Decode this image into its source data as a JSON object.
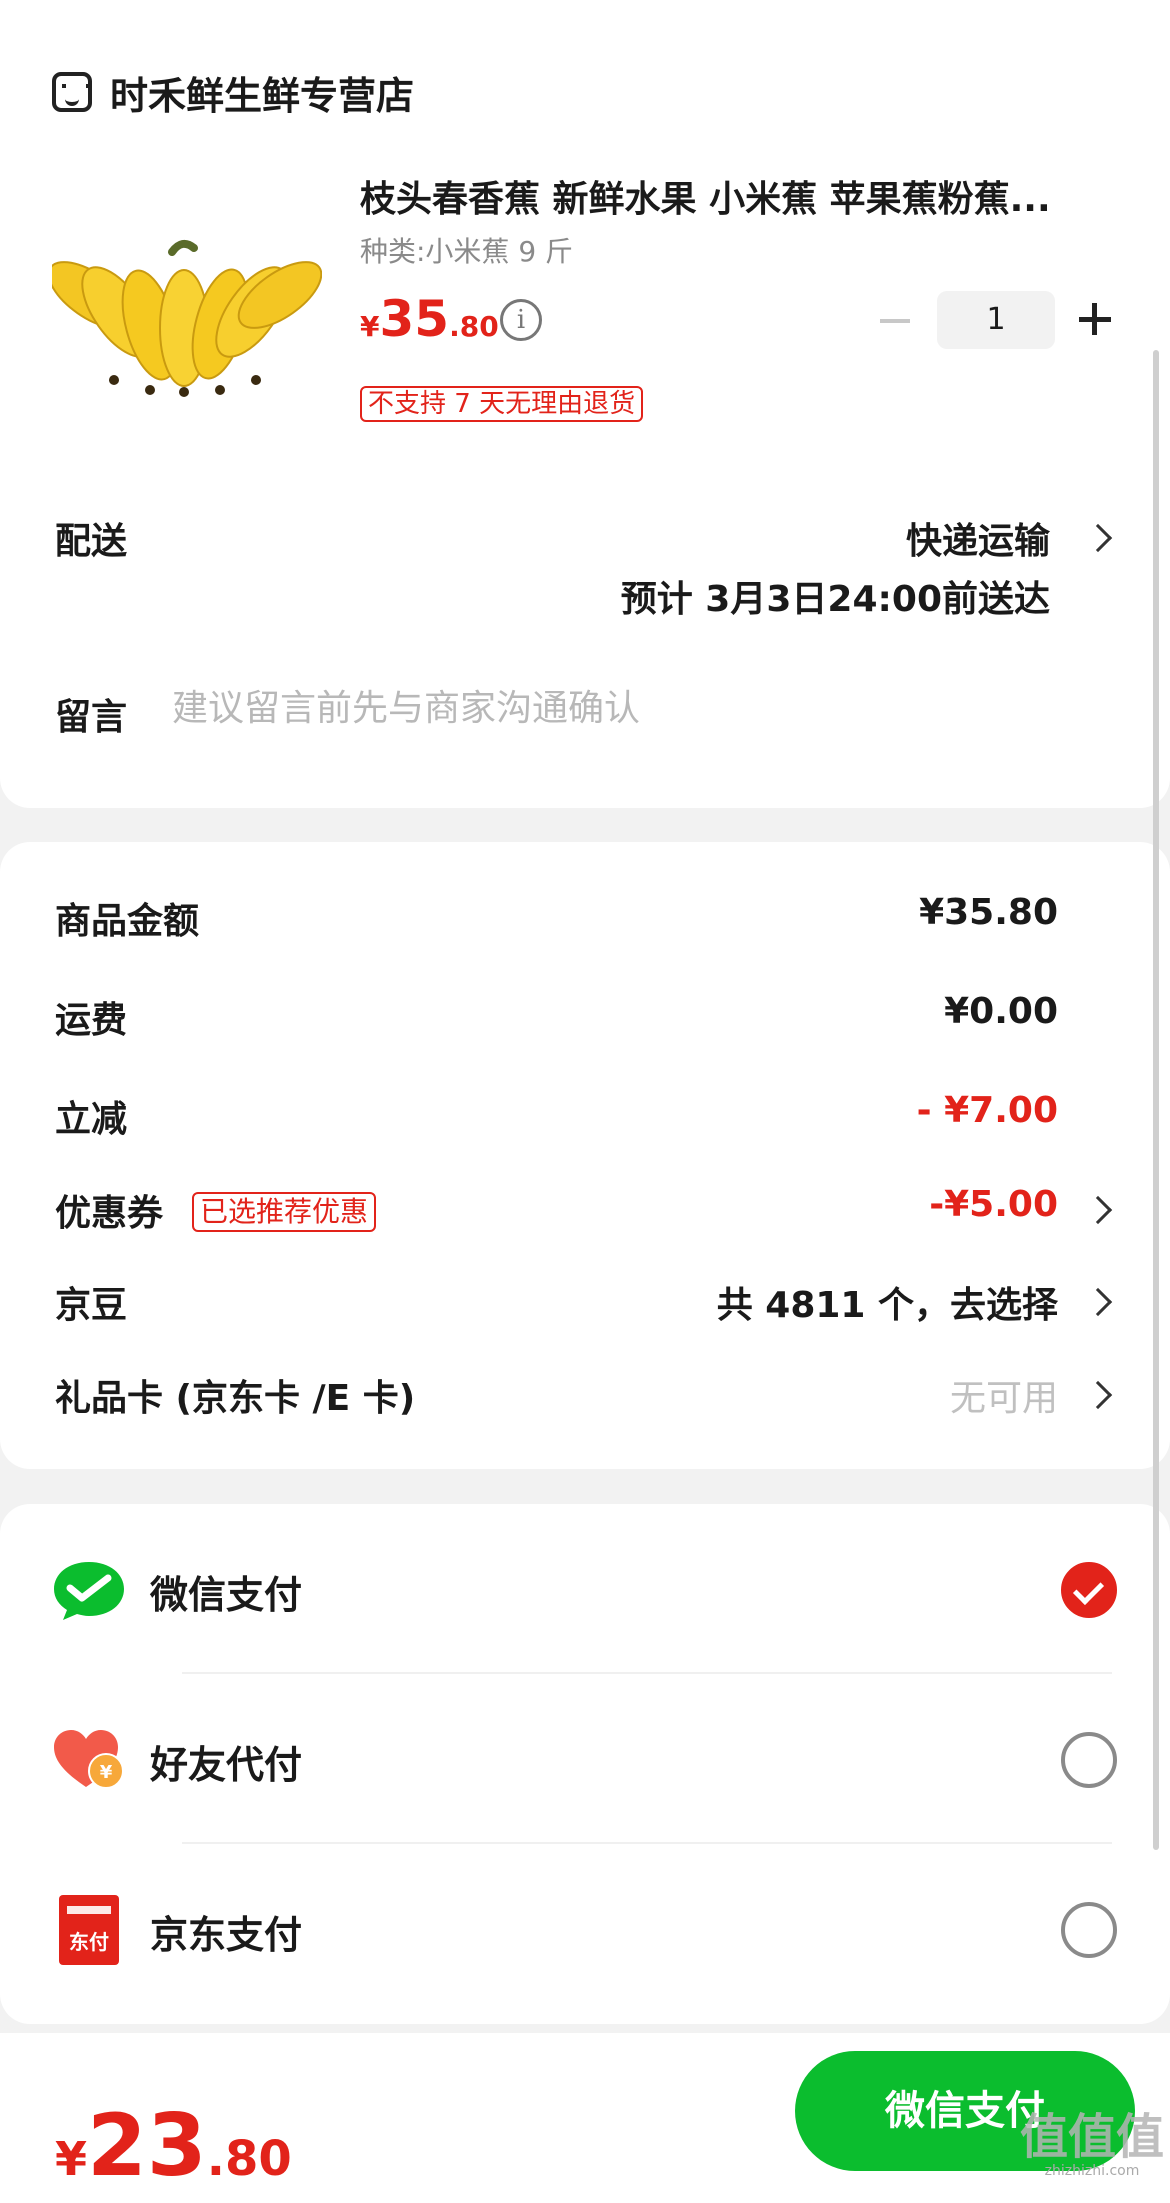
{
  "store": {
    "name": "时禾鲜生鲜专营店",
    "icon": "store-icon"
  },
  "product": {
    "title": "枝头春香蕉 新鲜水果 小米蕉 苹果蕉粉蕉...",
    "spec": "种类:小米蕉 9 斤",
    "price_symbol": "¥",
    "price_int": "35",
    "price_dec": ".80",
    "quantity": "1",
    "return_tag": "不支持 7 天无理由退货"
  },
  "delivery": {
    "label": "配送",
    "method": "快递运输",
    "eta": "预计 3月3日24:00前送达"
  },
  "remark": {
    "label": "留言",
    "placeholder": "建议留言前先与商家沟通确认"
  },
  "amounts": {
    "goods_label": "商品金额",
    "goods_value": "¥35.80",
    "shipping_label": "运费",
    "shipping_value": "¥0.00",
    "discount_label": "立减",
    "discount_value": "- ¥7.00",
    "coupon_label": "优惠券",
    "coupon_tag": "已选推荐优惠",
    "coupon_value": "-¥5.00",
    "jingdou_label": "京豆",
    "jingdou_value": "共 4811 个，去选择",
    "giftcard_label": "礼品卡 (京东卡 /E 卡)",
    "giftcard_value": "无可用"
  },
  "payment": {
    "methods": [
      {
        "name": "微信支付",
        "icon": "wechat-pay-icon",
        "selected": true
      },
      {
        "name": "好友代付",
        "icon": "friend-pay-icon",
        "selected": false
      },
      {
        "name": "京东支付",
        "icon": "jd-pay-icon",
        "selected": false
      }
    ],
    "jd_icon_text": "东付"
  },
  "bottom": {
    "total_symbol": "¥",
    "total_int": "23",
    "total_dec": ".80",
    "pay_button": "微信支付",
    "watermark": "值值值",
    "watermark_url": "zhizhizhi.com"
  },
  "colors": {
    "accent": "#e2231a",
    "wechat_green": "#0bbd2e"
  }
}
